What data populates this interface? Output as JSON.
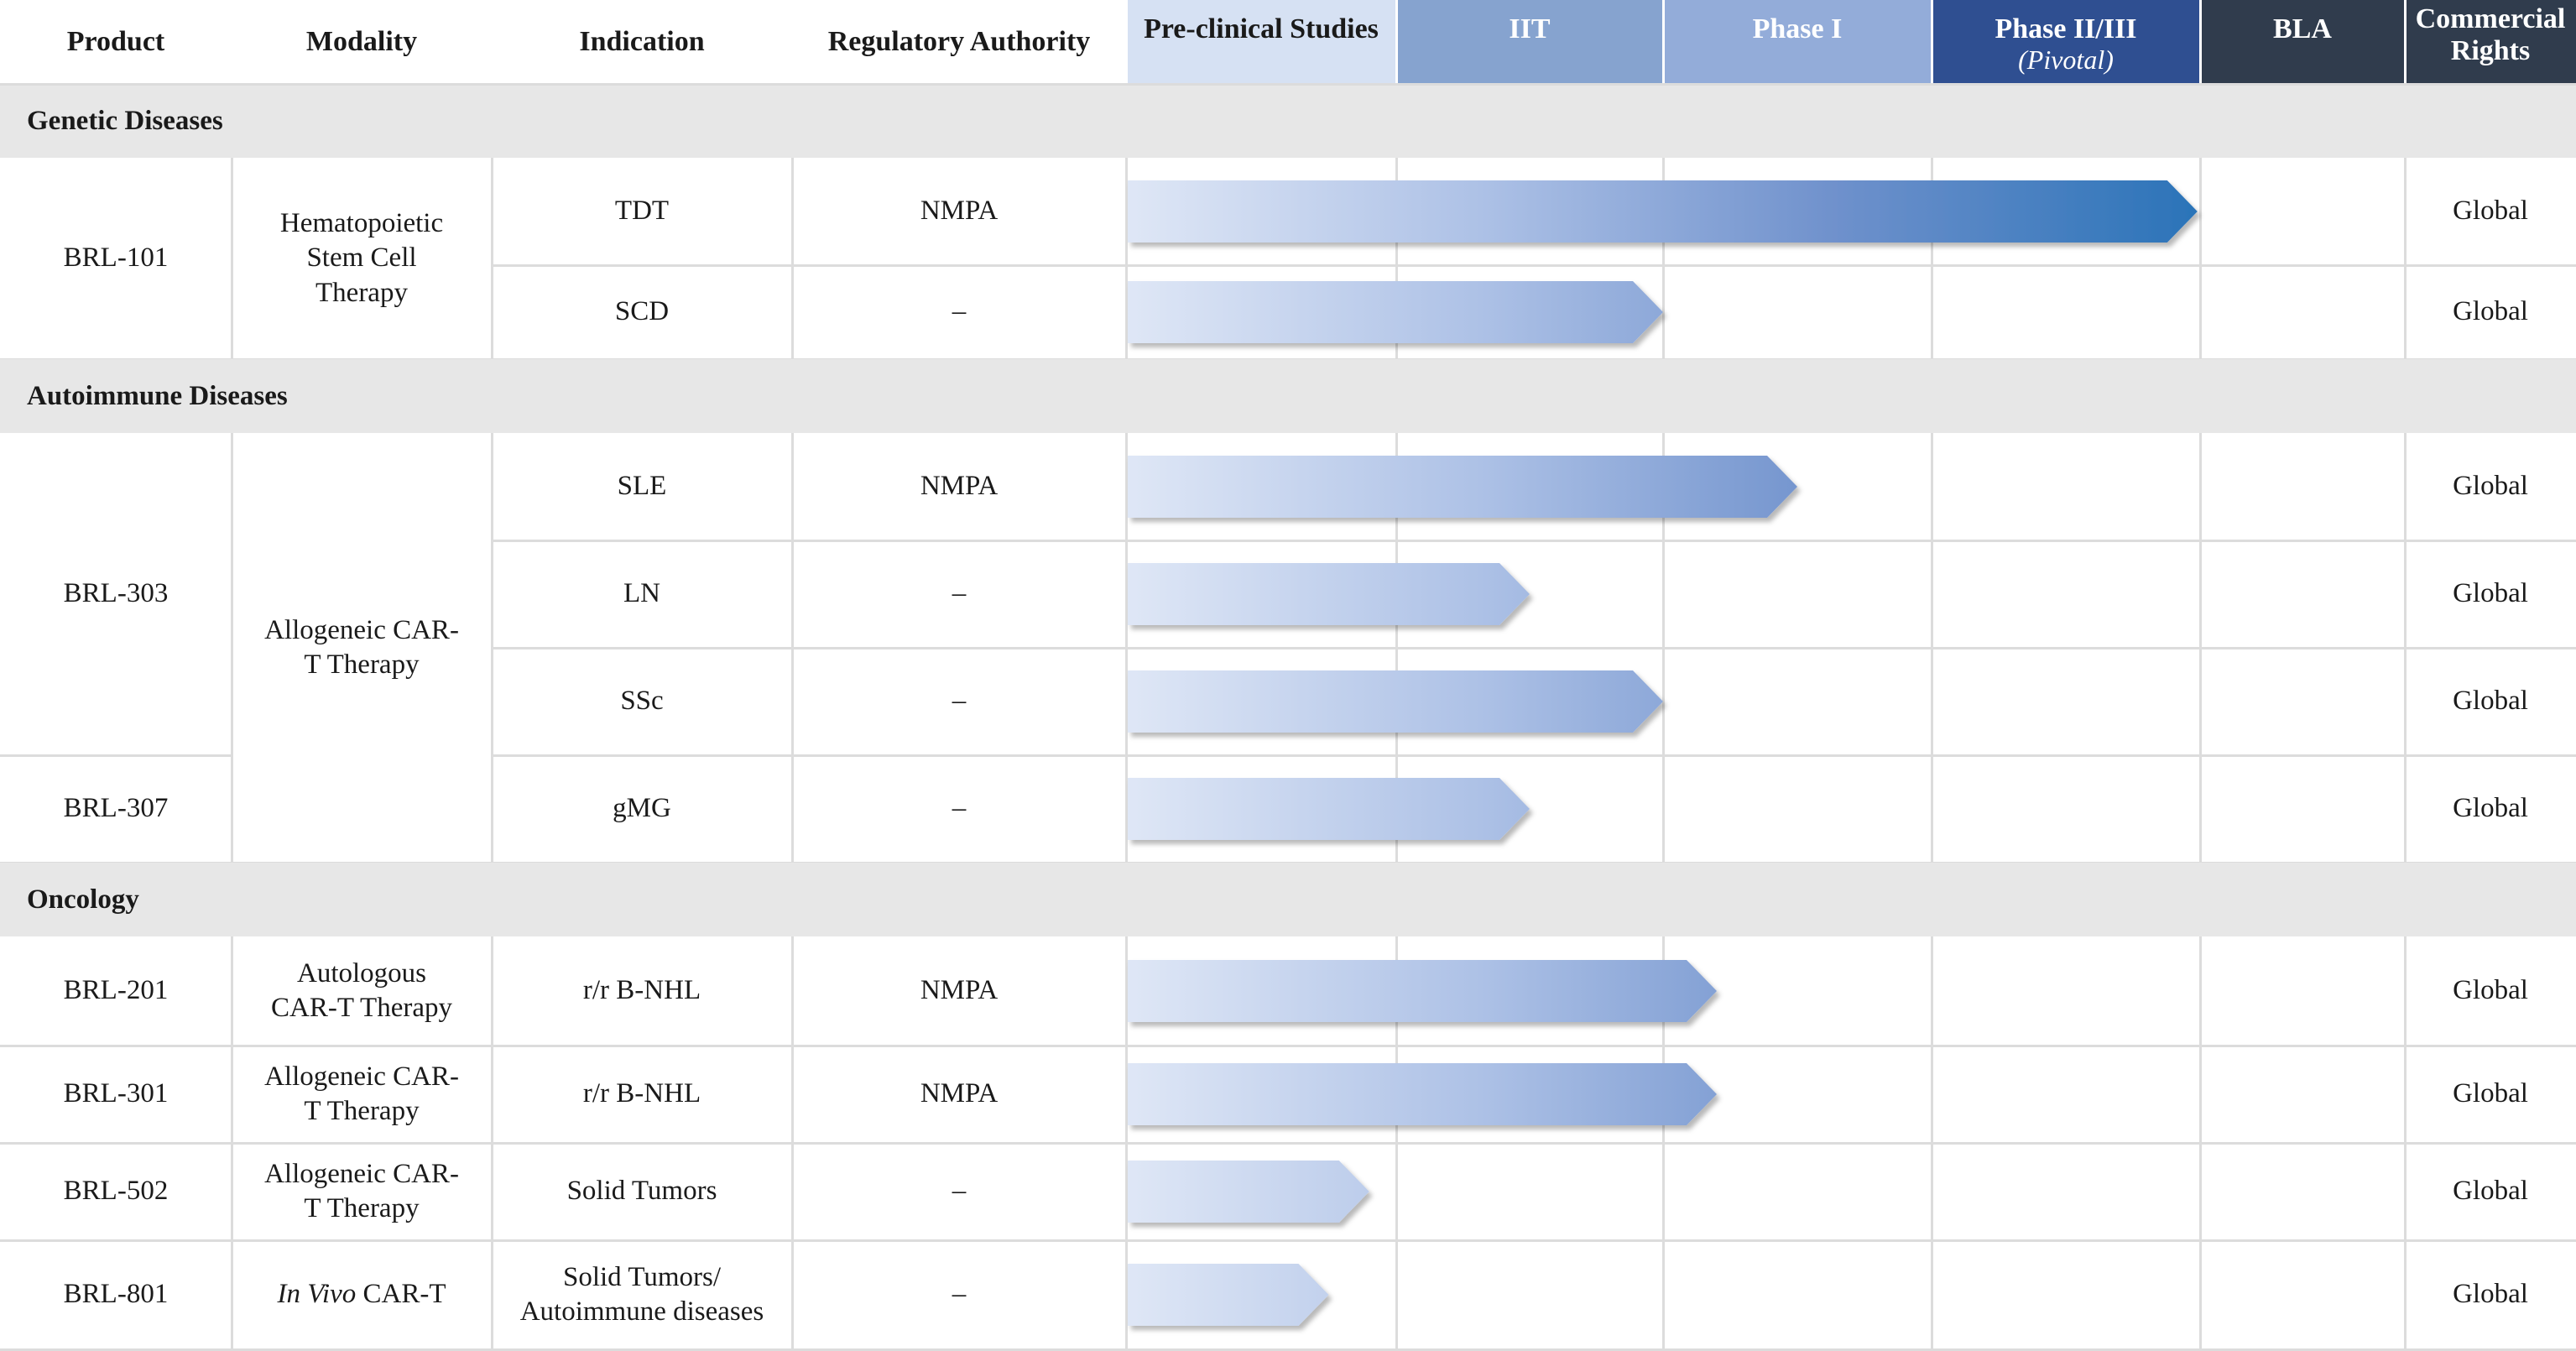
{
  "chart_data": {
    "type": "table",
    "title": "",
    "stages": [
      {
        "label": "Pre-clinical Studies",
        "sub": "",
        "fill": "#d6e1f3",
        "text": "#1a1a1a"
      },
      {
        "label": "IIT",
        "sub": "",
        "fill": "#86a3cf",
        "text": "#ffffff"
      },
      {
        "label": "Phase I",
        "sub": "",
        "fill": "#93acd9",
        "text": "#ffffff"
      },
      {
        "label": "Phase II/III",
        "sub": "(Pivotal)",
        "fill": "#2f4f91",
        "text": "#ffffff"
      },
      {
        "label": "BLA",
        "sub": "",
        "fill": "#303c4d",
        "text": "#ffffff"
      }
    ],
    "columns": {
      "product": "Product",
      "modality": "Modality",
      "indication": "Indication",
      "authority": "Regulatory Authority",
      "rights": "Commercial Rights"
    },
    "sections": [
      {
        "name": "Genetic Diseases",
        "products": [
          {
            "product": "BRL-101",
            "modality": "Hematopoietic Stem Cell Therapy",
            "rows": [
              {
                "indication": "TDT",
                "authority": "NMPA",
                "rights": "Global",
                "progress": 3.99
              },
              {
                "indication": "SCD",
                "authority": "–",
                "rights": "Global",
                "progress": 2.0
              }
            ]
          }
        ]
      },
      {
        "name": "Autoimmune Diseases",
        "modality_span": "Allogeneic CAR-T Therapy",
        "products": [
          {
            "product": "BRL-303",
            "modality": "",
            "rows": [
              {
                "indication": "SLE",
                "authority": "NMPA",
                "rights": "Global",
                "progress": 2.5
              },
              {
                "indication": "LN",
                "authority": "–",
                "rights": "Global",
                "progress": 1.5
              },
              {
                "indication": "SSc",
                "authority": "–",
                "rights": "Global",
                "progress": 2.0
              }
            ]
          },
          {
            "product": "BRL-307",
            "modality": "",
            "rows": [
              {
                "indication": "gMG",
                "authority": "–",
                "rights": "Global",
                "progress": 1.5
              }
            ]
          }
        ]
      },
      {
        "name": "Oncology",
        "products": [
          {
            "product": "BRL-201",
            "modality": "Autologous CAR-T Therapy",
            "rows": [
              {
                "indication": "r/r B-NHL",
                "authority": "NMPA",
                "rights": "Global",
                "progress": 2.2
              }
            ]
          },
          {
            "product": "BRL-301",
            "modality": "Allogeneic CAR-T Therapy",
            "rows": [
              {
                "indication": "r/r B-NHL",
                "authority": "NMPA",
                "rights": "Global",
                "progress": 2.2
              }
            ]
          },
          {
            "product": "BRL-502",
            "modality": "Allogeneic CAR-T Therapy",
            "rows": [
              {
                "indication": "Solid Tumors",
                "authority": "–",
                "rights": "Global",
                "progress": 0.9
              }
            ]
          },
          {
            "product": "BRL-801",
            "modality": "In Vivo CAR-T",
            "modality_italic": "In Vivo",
            "rows": [
              {
                "indication": "Solid Tumors/ Autoimmune diseases",
                "authority": "–",
                "rights": "Global",
                "progress": 0.75
              }
            ]
          }
        ]
      }
    ]
  }
}
